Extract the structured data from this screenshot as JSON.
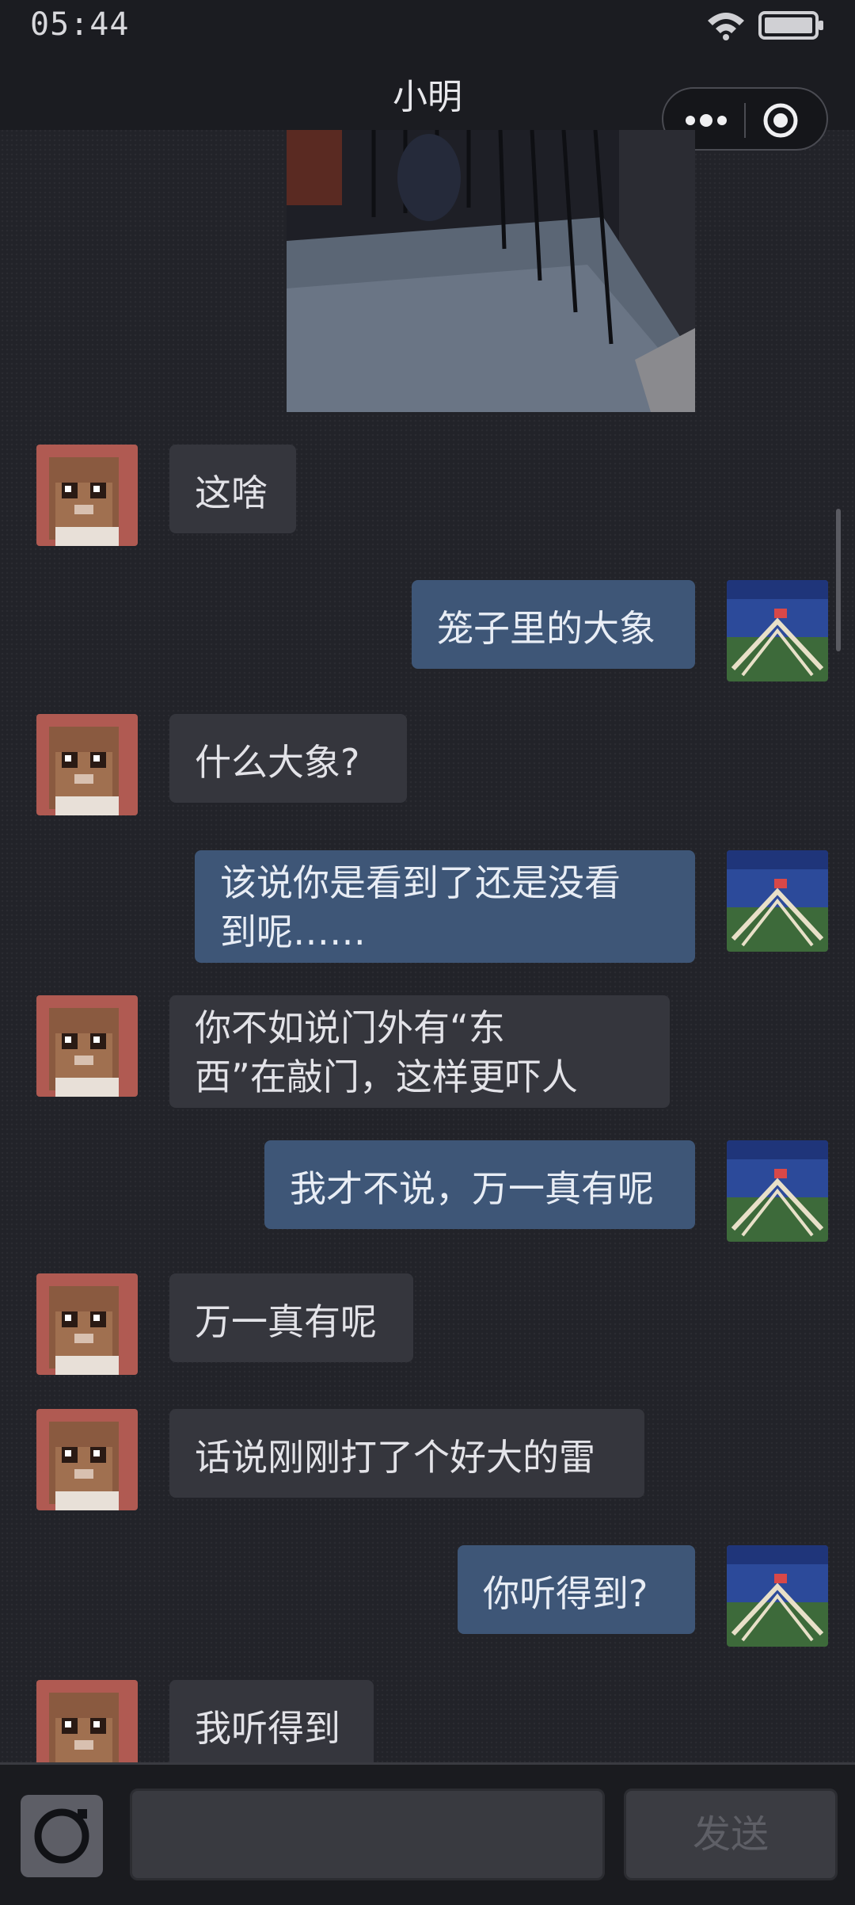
{
  "status_bar": {
    "time": "05:44"
  },
  "nav": {
    "title": "小明"
  },
  "messages": [
    {
      "side": "in",
      "text": "这啥"
    },
    {
      "side": "out",
      "text": "笼子里的大象"
    },
    {
      "side": "in",
      "text": "什么大象?"
    },
    {
      "side": "out",
      "text": "该说你是看到了还是没看\n到呢……"
    },
    {
      "side": "in",
      "text": "你不如说门外有“东\n西”在敲门，这样更吓人"
    },
    {
      "side": "out",
      "text": "我才不说，万一真有呢"
    },
    {
      "side": "in",
      "text": "万一真有呢"
    },
    {
      "side": "in",
      "text": "话说刚刚打了个好大的雷"
    },
    {
      "side": "out",
      "text": "你听得到?"
    },
    {
      "side": "in",
      "text": "我听得到"
    }
  ],
  "input_bar": {
    "placeholder": "",
    "send_label": "发送"
  },
  "colors": {
    "incoming_bubble": "#35363d",
    "outgoing_bubble": "#3e5677",
    "background": "#222329"
  }
}
